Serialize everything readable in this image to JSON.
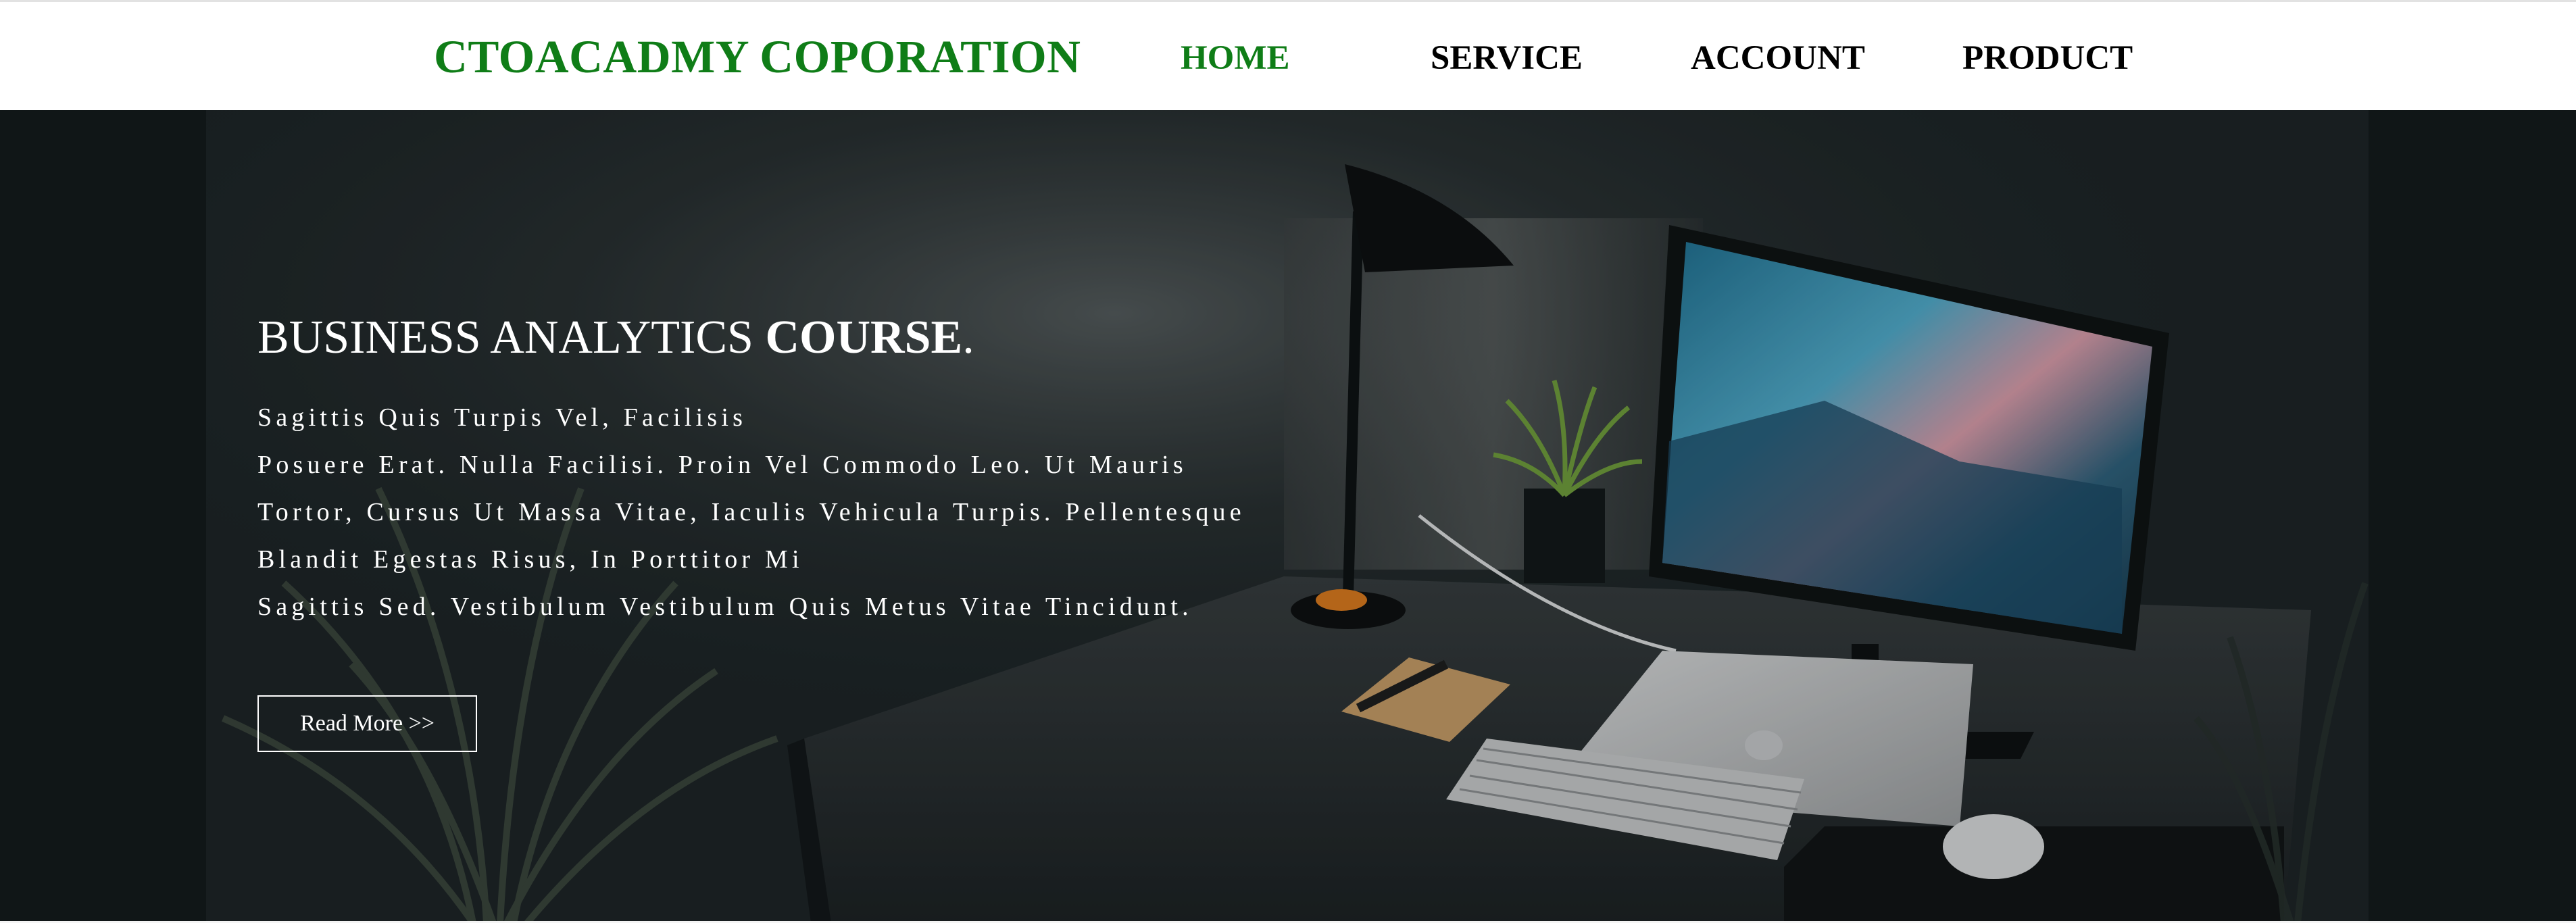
{
  "header": {
    "brand": "CTOACADMY COPORATION",
    "nav": [
      {
        "label": "HOME",
        "active": true
      },
      {
        "label": "SERVICE",
        "active": false
      },
      {
        "label": "ACCOUNT",
        "active": false
      },
      {
        "label": "PRODUCT",
        "active": false
      }
    ]
  },
  "hero": {
    "title_regular": "BUSINESS ANALYTICS ",
    "title_bold": "COURSE",
    "title_end": ".",
    "lines": [
      "Sagittis Quis Turpis Vel, Facilisis",
      "Posuere Erat. Nulla Facilisi. Proin Vel Commodo Leo. Ut Mauris",
      "Tortor, Cursus Ut Massa Vitae, Iaculis Vehicula Turpis. Pellentesque",
      "Blandit Egestas Risus, In Porttitor Mi",
      "Sagittis Sed. Vestibulum Vestibulum Quis Metus Vitae Tincidunt."
    ],
    "button_label": "Read More >>"
  },
  "colors": {
    "brand_green": "#0f7d17",
    "nav_text": "#000000",
    "hero_background": "#121819",
    "hero_text": "#ffffff"
  },
  "icons": {
    "background_image": "desk-setup-photo"
  }
}
